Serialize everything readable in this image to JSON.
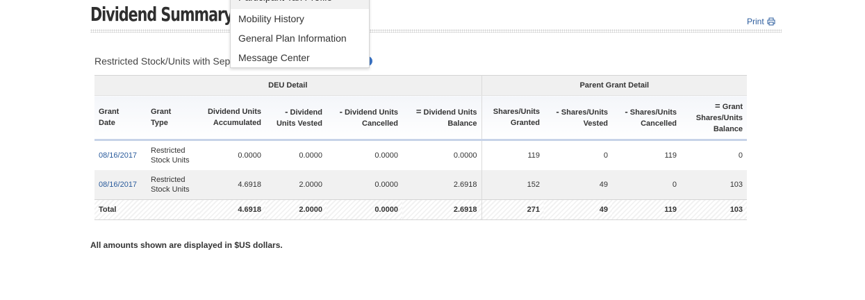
{
  "page": {
    "title": "Dividend Summary",
    "print_label": "Print",
    "print_icon": "printer-icon",
    "section_label": "Restricted Stock/Units with Sepa",
    "info_icon": "info-icon"
  },
  "dropdown": {
    "items": [
      "Participant Tax Profile",
      "Mobility History",
      "General Plan Information",
      "Message Center"
    ]
  },
  "table": {
    "groups": {
      "deu": "DEU Detail",
      "parent": "Parent Grant Detail"
    },
    "headers": [
      {
        "op": "",
        "label1": "Grant",
        "label2": "Date"
      },
      {
        "op": "",
        "label1": "Grant",
        "label2": "Type"
      },
      {
        "op": "",
        "label1": "Dividend Units",
        "label2": "Accumulated"
      },
      {
        "op": "-",
        "label1": "Dividend",
        "label2": "Units Vested"
      },
      {
        "op": "-",
        "label1": "Dividend Units",
        "label2": "Cancelled"
      },
      {
        "op": "=",
        "label1": "Dividend Units",
        "label2": "Balance"
      },
      {
        "op": "",
        "label1": "Shares/Units",
        "label2": "Granted"
      },
      {
        "op": "-",
        "label1": "Shares/Units",
        "label2": "Vested"
      },
      {
        "op": "-",
        "label1": "Shares/Units",
        "label2": "Cancelled"
      },
      {
        "op": "=",
        "label1": "Grant",
        "label2": "Shares/Units",
        "label3": "Balance"
      }
    ],
    "rows": [
      {
        "date": "08/16/2017",
        "type1": "Restricted",
        "type2": "Stock Units",
        "accumulated": "0.0000",
        "vested": "0.0000",
        "cancelled": "0.0000",
        "balance": "0.0000",
        "granted": "119",
        "sh_vested": "0",
        "sh_cancelled": "119",
        "sh_balance": "0"
      },
      {
        "date": "08/16/2017",
        "type1": "Restricted",
        "type2": "Stock Units",
        "accumulated": "4.6918",
        "vested": "2.0000",
        "cancelled": "0.0000",
        "balance": "2.6918",
        "granted": "152",
        "sh_vested": "49",
        "sh_cancelled": "0",
        "sh_balance": "103"
      }
    ],
    "total": {
      "label": "Total",
      "accumulated": "4.6918",
      "vested": "2.0000",
      "cancelled": "0.0000",
      "balance": "2.6918",
      "granted": "271",
      "sh_vested": "49",
      "sh_cancelled": "119",
      "sh_balance": "103"
    }
  },
  "footnote": "All amounts shown are displayed in $US dollars.",
  "colors": {
    "link": "#2a5b9c",
    "header_rule": "#c7d3e8",
    "row_alt": "#f1f1f1"
  }
}
